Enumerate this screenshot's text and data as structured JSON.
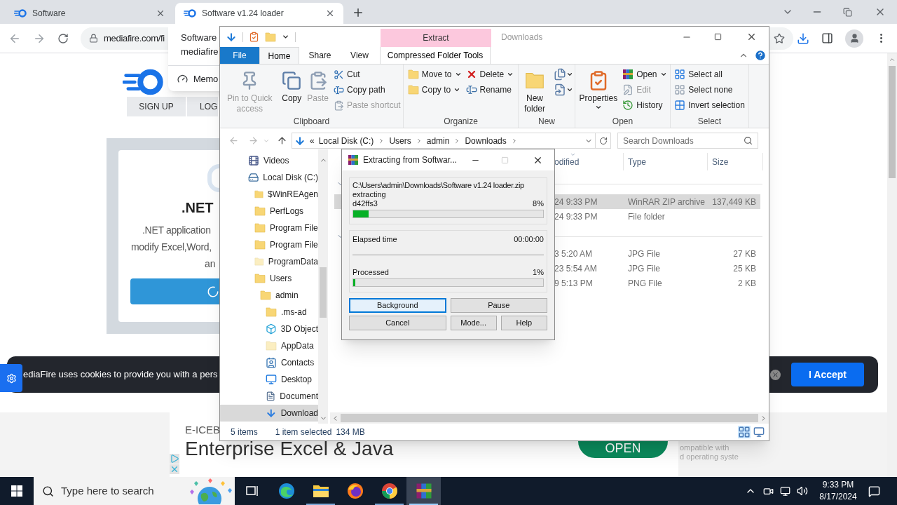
{
  "browser": {
    "tabs": [
      {
        "title": "Software",
        "selected": false
      },
      {
        "title": "Software v1.24 loader",
        "selected": true
      }
    ],
    "address": "mediafire.com/fi",
    "hover_card": {
      "title": "Software",
      "site": "mediafire",
      "memory": "Memo"
    },
    "page": {
      "nav": [
        "SIGN UP",
        "LOG"
      ],
      "card": {
        "title": ".NET",
        "lines": [
          ".NET application",
          "modify Excel,Word,",
          "an"
        ]
      },
      "cookie": {
        "text": "ediaFire uses cookies to provide you with a pers",
        "accept": "I Accept"
      },
      "ad": {
        "brand": "E-ICEB",
        "headline": "Enterprise Excel & Java",
        "button": "OPEN",
        "lines": [
          "ompatible with",
          "d operating syste"
        ]
      }
    }
  },
  "explorer": {
    "title": "Downloads",
    "context_label": "Extract",
    "tabs": [
      {
        "label": "File",
        "kind": "file",
        "selected": false
      },
      {
        "label": "Home",
        "kind": "tab",
        "selected": true
      },
      {
        "label": "Share",
        "kind": "tab",
        "selected": false
      },
      {
        "label": "View",
        "kind": "tab",
        "selected": false
      },
      {
        "label": "Compressed Folder Tools",
        "kind": "context",
        "selected": false
      }
    ],
    "ribbon": [
      {
        "label": "Clipboard",
        "columns": [
          [
            {
              "label": "Pin to Quick access",
              "kind": "large",
              "disabled": true,
              "dropdown": false
            }
          ],
          [
            {
              "label": "Copy",
              "kind": "large",
              "disabled": false,
              "dropdown": false
            }
          ],
          [
            {
              "label": "Paste",
              "kind": "large",
              "disabled": true,
              "dropdown": false
            }
          ],
          [
            {
              "label": "Cut",
              "kind": "small",
              "disabled": false,
              "dropdown": false
            },
            {
              "label": "Copy path",
              "kind": "small",
              "disabled": false,
              "dropdown": false
            },
            {
              "label": "Paste shortcut",
              "kind": "small",
              "disabled": true,
              "dropdown": false
            }
          ]
        ]
      },
      {
        "label": "Organize",
        "columns": [
          [
            {
              "label": "Move to",
              "kind": "small",
              "disabled": false,
              "dropdown": true
            },
            {
              "label": "Copy to",
              "kind": "small",
              "disabled": false,
              "dropdown": true
            }
          ],
          [
            {
              "label": "Delete",
              "kind": "small",
              "disabled": false,
              "dropdown": true
            },
            {
              "label": "Rename",
              "kind": "small",
              "disabled": false,
              "dropdown": false
            }
          ]
        ]
      },
      {
        "label": "New",
        "columns": [
          [
            {
              "label": "New folder",
              "kind": "large",
              "disabled": false,
              "dropdown": false
            }
          ],
          [
            {
              "kind": "icon",
              "disabled": false,
              "dropdown": true
            },
            {
              "kind": "icon",
              "disabled": false,
              "dropdown": true
            }
          ]
        ]
      },
      {
        "label": "Open",
        "columns": [
          [
            {
              "label": "Properties",
              "kind": "large",
              "disabled": false,
              "dropdown": true
            }
          ],
          [
            {
              "label": "Open",
              "kind": "small",
              "disabled": false,
              "dropdown": true
            },
            {
              "label": "Edit",
              "kind": "small",
              "disabled": true,
              "dropdown": false
            },
            {
              "label": "History",
              "kind": "small",
              "disabled": false,
              "dropdown": false
            }
          ]
        ]
      },
      {
        "label": "Select",
        "columns": [
          [
            {
              "label": "Select all",
              "kind": "small",
              "disabled": false,
              "dropdown": false
            },
            {
              "label": "Select none",
              "kind": "small",
              "disabled": false,
              "dropdown": false
            },
            {
              "label": "Invert selection",
              "kind": "small",
              "disabled": false,
              "dropdown": false
            }
          ]
        ]
      }
    ],
    "overflow": "«",
    "breadcrumbs": [
      "Local Disk (C:)",
      "Users",
      "admin",
      "Downloads"
    ],
    "search_placeholder": "Search Downloads",
    "nav": [
      {
        "label": "Videos",
        "kind": "videos",
        "selected": false
      },
      {
        "label": "Local Disk (C:)",
        "kind": "drive",
        "selected": false,
        "children": [
          {
            "label": "$WinREAgen",
            "kind": "folder",
            "selected": false
          },
          {
            "label": "PerfLogs",
            "kind": "folder",
            "selected": false
          },
          {
            "label": "Program File",
            "kind": "folder",
            "selected": false
          },
          {
            "label": "Program File",
            "kind": "folder",
            "selected": false
          },
          {
            "label": "ProgramData",
            "kind": "pale",
            "selected": false
          },
          {
            "label": "Users",
            "kind": "folder",
            "selected": false,
            "children": [
              {
                "label": "admin",
                "kind": "folder",
                "selected": false,
                "children": [
                  {
                    "label": ".ms-ad",
                    "kind": "folder",
                    "selected": false
                  },
                  {
                    "label": "3D Object",
                    "kind": "cube",
                    "selected": false
                  },
                  {
                    "label": "AppData",
                    "kind": "pale",
                    "selected": false
                  },
                  {
                    "label": "Contacts",
                    "kind": "contacts",
                    "selected": false
                  },
                  {
                    "label": "Desktop",
                    "kind": "desktop",
                    "selected": false
                  },
                  {
                    "label": "Document",
                    "kind": "documents",
                    "selected": false
                  },
                  {
                    "label": "Download",
                    "kind": "downloads",
                    "selected": true
                  }
                ]
              }
            ]
          }
        ]
      }
    ],
    "columns": [
      "odified",
      "Type",
      "Size"
    ],
    "groups": [
      {
        "rows": [
          {
            "date": "24 9:33 PM",
            "type": "WinRAR ZIP archive",
            "size": "137,449 KB",
            "selected": true
          },
          {
            "date": "24 9:33 PM",
            "type": "File folder",
            "size": "",
            "selected": false
          }
        ]
      },
      {
        "rows": [
          {
            "date": "3 5:20 AM",
            "type": "JPG File",
            "size": "27 KB",
            "selected": false
          },
          {
            "date": "23 5:54 AM",
            "type": "JPG File",
            "size": "25 KB",
            "selected": false
          },
          {
            "date": "9 5:13 PM",
            "type": "PNG File",
            "size": "2 KB",
            "selected": false
          }
        ]
      }
    ],
    "status": {
      "count": "5 items",
      "selection": "1 item selected",
      "size": "134 MB"
    }
  },
  "dialog": {
    "title": "Extracting from Softwar...",
    "archive": "C:\\Users\\admin\\Downloads\\Software v1.24 loader.zip",
    "action": "extracting",
    "file": "d42ffs3",
    "file_percent": "8%",
    "file_progress": {
      "level": 0.08
    },
    "elapsed_label": "Elapsed time",
    "elapsed": "00:00:00",
    "processed_label": "Processed",
    "processed_percent": "1%",
    "processed_progress": {
      "level": 0.01
    },
    "buttons": [
      {
        "label": "Background",
        "kind": "default"
      },
      {
        "label": "Pause",
        "kind": "normal"
      },
      {
        "label": "Cancel",
        "kind": "normal"
      },
      {
        "label": "Mode...",
        "kind": "normal"
      },
      {
        "label": "Help",
        "kind": "normal"
      }
    ]
  },
  "taskbar": {
    "search_placeholder": "Type here to search",
    "apps": [
      {
        "kind": "taskview",
        "running": false,
        "selected": false
      },
      {
        "kind": "edge",
        "running": false,
        "selected": false
      },
      {
        "kind": "explorer",
        "running": true,
        "selected": false
      },
      {
        "kind": "firefox",
        "running": false,
        "selected": false
      },
      {
        "kind": "chrome",
        "running": true,
        "selected": false
      },
      {
        "kind": "winrar",
        "running": true,
        "selected": true
      }
    ],
    "time": "9:33 PM",
    "date": "8/17/2024"
  }
}
